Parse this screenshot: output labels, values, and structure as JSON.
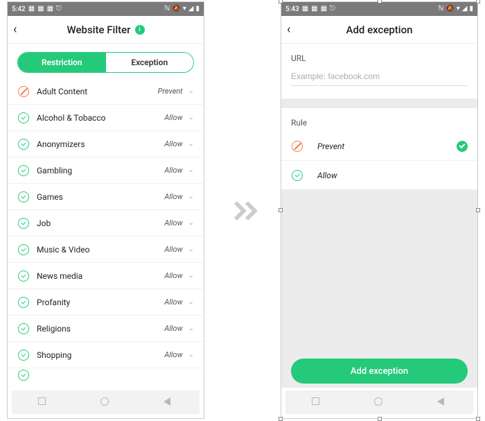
{
  "left": {
    "status": {
      "time": "5:42"
    },
    "header": {
      "title": "Website Filter"
    },
    "tabs": {
      "restriction": "Restriction",
      "exception": "Exception"
    },
    "actions": {
      "prevent": "Prevent",
      "allow": "Allow"
    },
    "categories": [
      {
        "label": "Adult Content",
        "action": "prevent"
      },
      {
        "label": "Alcohol & Tobacco",
        "action": "allow"
      },
      {
        "label": "Anonymizers",
        "action": "allow"
      },
      {
        "label": "Gambling",
        "action": "allow"
      },
      {
        "label": "Games",
        "action": "allow"
      },
      {
        "label": "Job",
        "action": "allow"
      },
      {
        "label": "Music & Video",
        "action": "allow"
      },
      {
        "label": "News media",
        "action": "allow"
      },
      {
        "label": "Profanity",
        "action": "allow"
      },
      {
        "label": "Religions",
        "action": "allow"
      },
      {
        "label": "Shopping",
        "action": "allow"
      }
    ]
  },
  "right": {
    "status": {
      "time": "5:43"
    },
    "header": {
      "title": "Add exception"
    },
    "url": {
      "label": "URL",
      "placeholder": "Example: facebook.com"
    },
    "rule": {
      "label": "Rule",
      "options": {
        "prevent": "Prevent",
        "allow": "Allow"
      },
      "selected": "prevent"
    },
    "button": "Add exception"
  }
}
